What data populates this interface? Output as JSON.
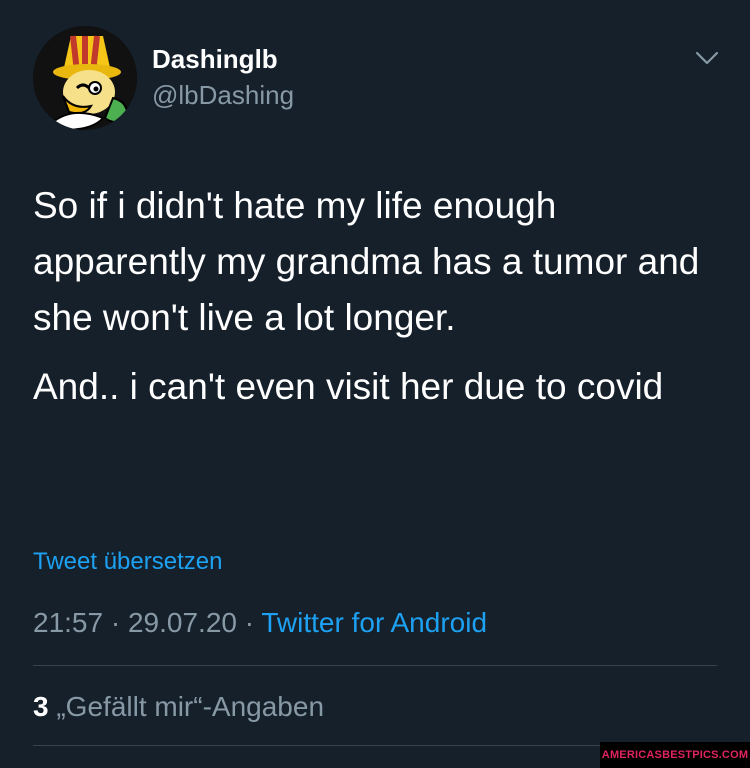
{
  "user": {
    "display_name": "Dashinglb",
    "handle": "@lbDashing",
    "avatar_icon": "hammer-bro-avatar"
  },
  "menu": {
    "icon": "chevron-down-icon"
  },
  "tweet": {
    "paragraphs": [
      "So if i didn't hate my life enough apparently my grandma has a tumor and she won't live a lot longer.",
      "And.. i can't even visit her due to covid"
    ]
  },
  "translate_label": "Tweet übersetzen",
  "meta": {
    "time": "21:57",
    "sep1": " · ",
    "date": "29.07.20",
    "sep2": " · ",
    "source": "Twitter for Android"
  },
  "likes": {
    "count": "3",
    "label": " „Gefällt mir“-Angaben"
  },
  "watermark": "AMERICASBESTPICS.COM",
  "colors": {
    "background": "#15202b",
    "text": "#ffffff",
    "secondary": "#8899a6",
    "link": "#1da1f2",
    "divider": "#38444d"
  }
}
